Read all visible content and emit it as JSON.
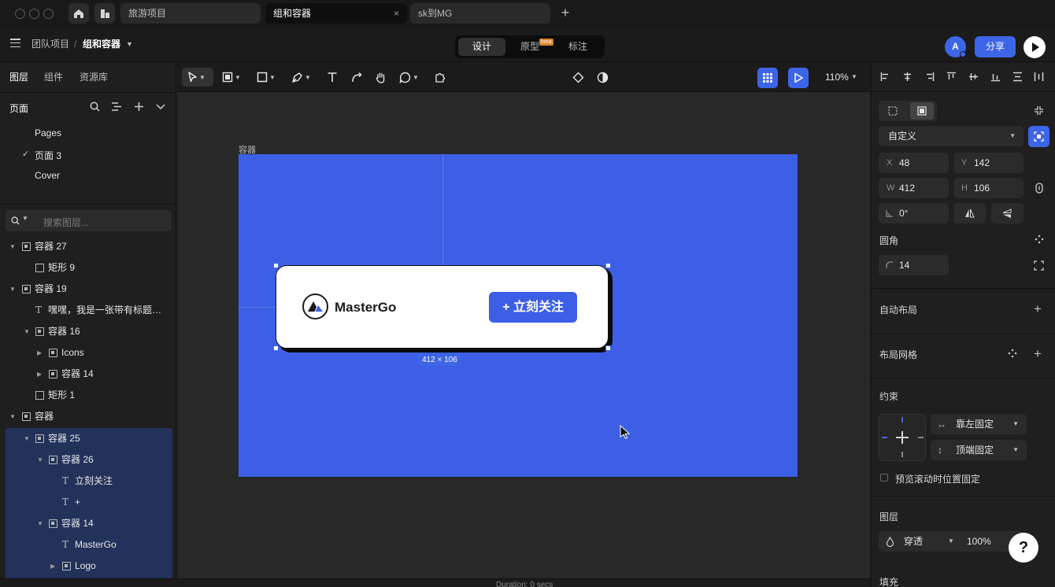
{
  "tabs": {
    "items": [
      {
        "label": "旅游项目"
      },
      {
        "label": "组和容器"
      },
      {
        "label": "sk到MG"
      }
    ],
    "close_glyph": "×",
    "add_glyph": "+"
  },
  "header": {
    "breadcrumb_team": "团队项目",
    "breadcrumb_sep": "/",
    "breadcrumb_file": "组和容器",
    "modes": [
      "设计",
      "原型",
      "标注"
    ],
    "beta": "beta",
    "avatar_initial": "A",
    "share_label": "分享"
  },
  "left_panel": {
    "tabs": [
      "图层",
      "组件",
      "资源库"
    ],
    "pages_title": "页面",
    "pages": [
      "Pages",
      "页面 3",
      "Cover"
    ],
    "current_page_check": "✓",
    "search_placeholder": "搜索图层...",
    "layers": [
      {
        "label": "容器 27"
      },
      {
        "label": "矩形 9"
      },
      {
        "label": "容器 19"
      },
      {
        "label": "嘿嘿，我是一张带有标题和几..."
      },
      {
        "label": "容器 16"
      },
      {
        "label": "Icons"
      },
      {
        "label": "容器 14"
      },
      {
        "label": "矩形 1"
      },
      {
        "label": "容器"
      },
      {
        "label": "容器 25"
      },
      {
        "label": "容器 26"
      },
      {
        "label": "立刻关注"
      },
      {
        "label": "+"
      },
      {
        "label": "容器 14"
      },
      {
        "label": "MasterGo"
      },
      {
        "label": "Logo"
      }
    ]
  },
  "toolbar": {
    "zoom": "110%"
  },
  "canvas": {
    "frame_label": "容器",
    "brand": "MasterGo",
    "follow_button": "+ 立刻关注",
    "dimension_label": "412 × 106",
    "duration": "Duration: 0 secs"
  },
  "right_panel": {
    "preset": "自定义",
    "x_label": "X",
    "x": "48",
    "y_label": "Y",
    "y": "142",
    "w_label": "W",
    "w": "412",
    "h_label": "H",
    "h": "106",
    "rotation": "0°",
    "radius_title": "圆角",
    "radius": "14",
    "auto_layout": "自动布局",
    "layout_grid": "布局网格",
    "constraints": "约束",
    "constraint_h": "靠左固定",
    "constraint_v": "顶端固定",
    "fix_on_scroll": "预览滚动时位置固定",
    "layer_title": "图层",
    "blend": "穿透",
    "opacity": "100%",
    "fill": "填充",
    "help": "?"
  },
  "colors": {
    "accent": "#3d65e8",
    "frame": "#3d5fe6"
  }
}
